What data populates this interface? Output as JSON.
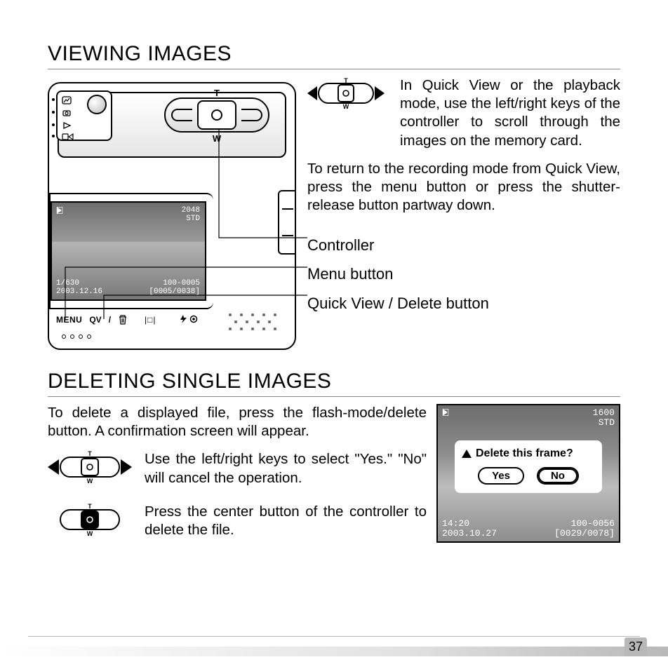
{
  "page_number": "37",
  "section1": {
    "title": "VIEWING IMAGES",
    "controller_letters": {
      "t": "T",
      "w": "W"
    },
    "paragraph1": "In Quick View or the playback mode, use the left/right keys of the controller to scroll through the images on the memory card.",
    "paragraph2": "To return to the recording mode from Quick View, press the menu button or press the shutter-release button partway down.",
    "labels": {
      "controller": "Controller",
      "menu_button": "Menu button",
      "qv_delete": "Quick View / Delete button"
    }
  },
  "camera": {
    "buttons": {
      "menu": "MENU",
      "qv": "QV",
      "disp": "|□|",
      "flash": "⚡👁"
    }
  },
  "lcd_main": {
    "top_left_icon": "▣",
    "top_right_res": "2048",
    "top_right_quality": "STD",
    "shutter": "1/630",
    "date": "2003.12.16",
    "folder_file": "100-0005",
    "count": "[0005/0038]"
  },
  "section2": {
    "title": "DELETING SINGLE IMAGES",
    "intro": "To delete a displayed file, press the flash-mode/delete button. A confirmation screen will appear.",
    "step1": "Use the left/right keys to select \"Yes.\" \"No\" will cancel the operation.",
    "step2": "Press the center button of the controller to delete the file."
  },
  "dialog": {
    "question": "Delete this frame?",
    "yes": "Yes",
    "no": "No"
  },
  "lcd_dialog": {
    "top_left_icon": "▣",
    "top_right_res": "1600",
    "top_right_quality": "STD",
    "time": "14:20",
    "date": "2003.10.27",
    "folder_file": "100-0056",
    "count": "[0029/0078]"
  }
}
